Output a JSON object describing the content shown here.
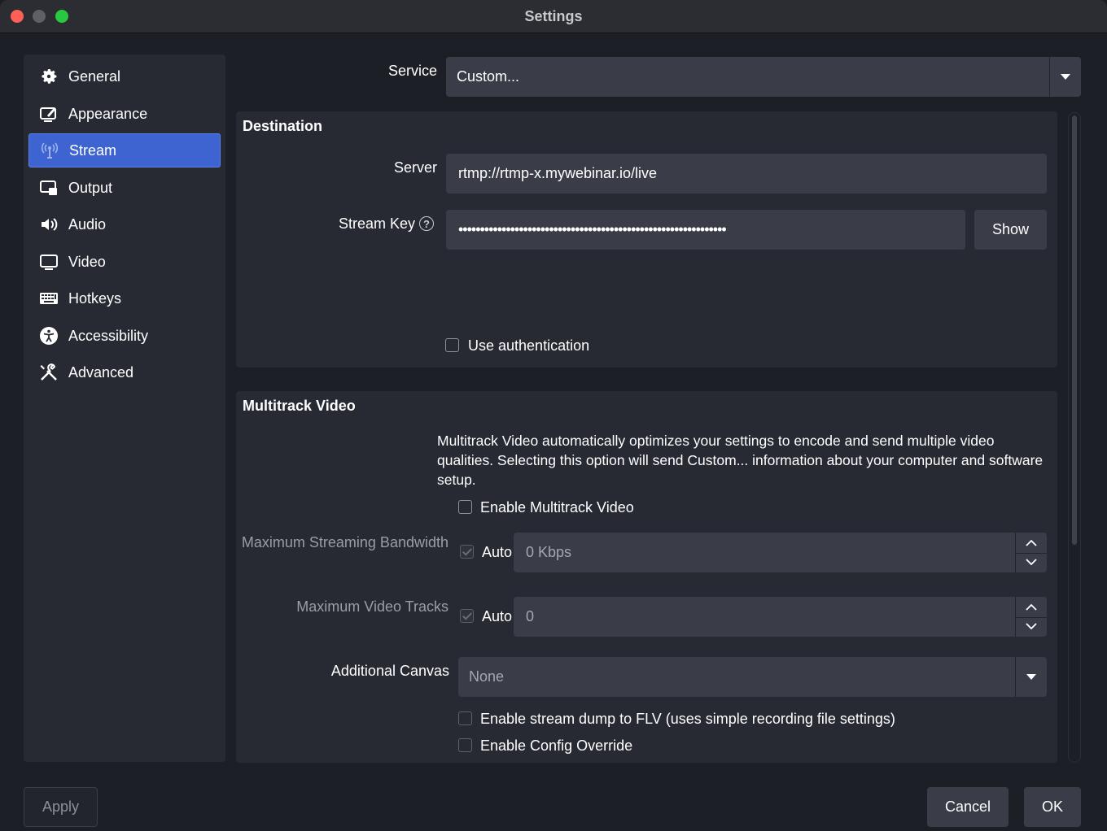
{
  "window": {
    "title": "Settings"
  },
  "sidebar": {
    "items": [
      {
        "label": "General",
        "icon": "gear-icon"
      },
      {
        "label": "Appearance",
        "icon": "appearance-icon"
      },
      {
        "label": "Stream",
        "icon": "antenna-icon",
        "active": true
      },
      {
        "label": "Output",
        "icon": "output-icon"
      },
      {
        "label": "Audio",
        "icon": "speaker-icon"
      },
      {
        "label": "Video",
        "icon": "monitor-icon"
      },
      {
        "label": "Hotkeys",
        "icon": "keyboard-icon"
      },
      {
        "label": "Accessibility",
        "icon": "accessibility-icon"
      },
      {
        "label": "Advanced",
        "icon": "tools-icon"
      }
    ]
  },
  "service": {
    "label": "Service",
    "value": "Custom..."
  },
  "destination": {
    "title": "Destination",
    "server_label": "Server",
    "server_value": "rtmp://rtmp-x.mywebinar.io/live",
    "stream_key_label": "Stream Key",
    "stream_key_value": "••••••••••••••••••••••••••••••••••••••••••••••••••••••••••••••",
    "show_button": "Show",
    "use_auth_label": "Use authentication"
  },
  "multitrack": {
    "title": "Multitrack Video",
    "description": "Multitrack Video automatically optimizes your settings to encode and send multiple video qualities. Selecting this option will send Custom... information about your computer and software setup.",
    "enable_label": "Enable Multitrack Video",
    "max_bandwidth_label": "Maximum Streaming Bandwidth",
    "max_bandwidth_auto": "Auto",
    "max_bandwidth_value": "0 Kbps",
    "max_tracks_label": "Maximum Video Tracks",
    "max_tracks_auto": "Auto",
    "max_tracks_value": "0",
    "additional_canvas_label": "Additional Canvas",
    "additional_canvas_value": "None",
    "stream_dump_label": "Enable stream dump to FLV (uses simple recording file settings)",
    "config_override_label": "Enable Config Override"
  },
  "footer": {
    "apply": "Apply",
    "cancel": "Cancel",
    "ok": "OK"
  },
  "colors": {
    "accent": "#3e64d2",
    "background": "#1d1f26",
    "panel": "#272a33",
    "field": "#3a3d48"
  }
}
